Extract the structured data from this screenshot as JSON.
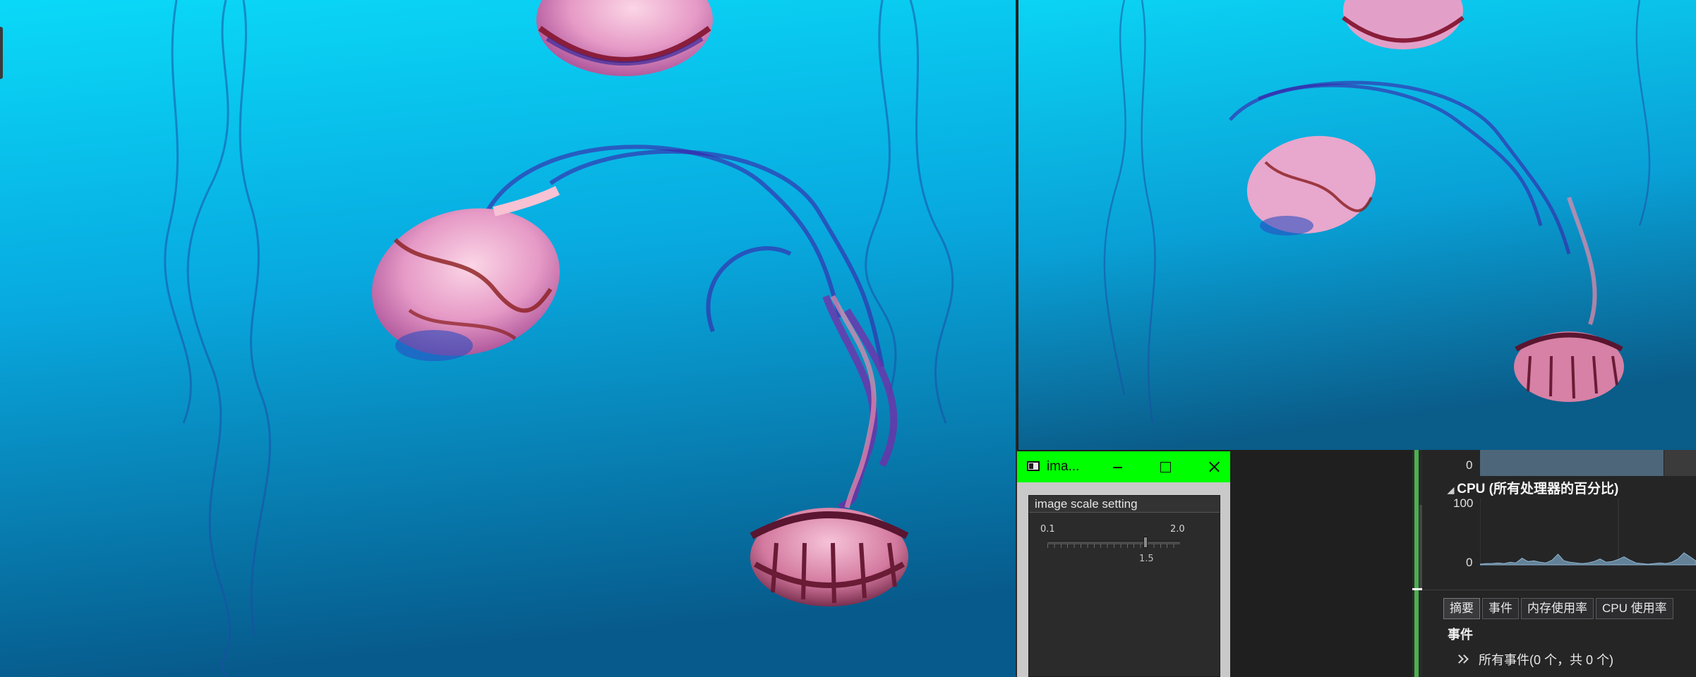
{
  "image_window": {
    "title": "ima...",
    "panel_title": "image scale setting",
    "slider": {
      "min_label": "0.1",
      "max_label": "2.0",
      "value_label": "1.5",
      "value": 1.5,
      "min": 0.1,
      "max": 2.0
    }
  },
  "diagnostics": {
    "memory_axis_min": "0",
    "cpu_section_title": "CPU (所有处理器的百分比)",
    "cpu_axis_max": "100",
    "cpu_axis_min": "0",
    "tabs": [
      "摘要",
      "事件",
      "内存使用率",
      "CPU 使用率"
    ],
    "events_heading": "事件",
    "events_summary": "所有事件(0 个，共 0 个)"
  },
  "colors": {
    "titlebar_green": "#00ff00",
    "water_light": "#0ad4f6",
    "water_dark": "#0a5a86",
    "cpu_fill": "#6f93ad",
    "splitter_green": "#4caf50"
  },
  "chart_data": {
    "type": "area",
    "ylim": [
      0,
      100
    ],
    "series": [
      {
        "values": [
          1,
          2,
          2,
          3,
          2,
          4,
          3,
          10,
          5,
          6,
          4,
          3,
          7,
          16,
          6,
          4,
          3,
          2,
          3,
          5,
          9,
          4,
          5,
          8,
          12,
          7,
          3,
          2,
          1,
          2,
          3,
          2,
          4,
          9,
          18,
          12,
          6
        ]
      }
    ]
  }
}
